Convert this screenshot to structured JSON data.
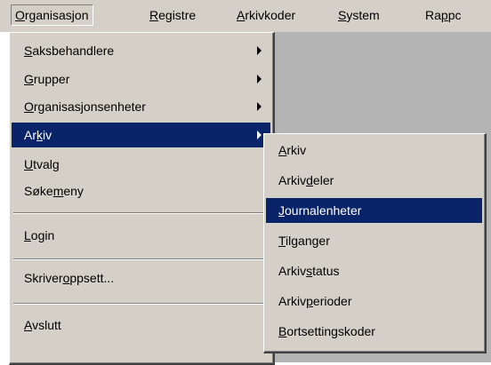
{
  "menubar": {
    "items": [
      {
        "pre": "",
        "ul": "O",
        "post": "rganisasjon"
      },
      {
        "pre": "",
        "ul": "R",
        "post": "egistre"
      },
      {
        "pre": "",
        "ul": "A",
        "post": "rkivkoder"
      },
      {
        "pre": "",
        "ul": "S",
        "post": "ystem"
      },
      {
        "pre": "Ra",
        "ul": "p",
        "post": "pc"
      }
    ]
  },
  "main_menu": {
    "items": [
      {
        "pre": "",
        "ul": "S",
        "post": "aksbehandlere"
      },
      {
        "pre": "",
        "ul": "G",
        "post": "rupper"
      },
      {
        "pre": "",
        "ul": "O",
        "post": "rganisasjonsenheter"
      },
      {
        "pre": "Ar",
        "ul": "k",
        "post": "iv"
      },
      {
        "pre": "",
        "ul": "U",
        "post": "tvalg"
      },
      {
        "pre": "Søke",
        "ul": "m",
        "post": "eny"
      },
      {
        "pre": "",
        "ul": "L",
        "post": "ogin"
      },
      {
        "pre": "Skriver",
        "ul": "o",
        "post": "ppsett..."
      },
      {
        "pre": "",
        "ul": "A",
        "post": "vslutt"
      }
    ]
  },
  "sub_menu": {
    "items": [
      {
        "pre": "",
        "ul": "A",
        "post": "rkiv"
      },
      {
        "pre": "Arkiv",
        "ul": "d",
        "post": "eler"
      },
      {
        "pre": "",
        "ul": "J",
        "post": "ournalenheter"
      },
      {
        "pre": "",
        "ul": "T",
        "post": "ilganger"
      },
      {
        "pre": "Arkiv",
        "ul": "s",
        "post": "tatus"
      },
      {
        "pre": "Arkiv",
        "ul": "p",
        "post": "erioder"
      },
      {
        "pre": "",
        "ul": "B",
        "post": "ortsettingskoder"
      }
    ]
  },
  "colors": {
    "menu_bg": "#d4d0c8",
    "highlight": "#0a246a",
    "app_bg": "#b4b4b4",
    "accent": "#2f8cff"
  }
}
